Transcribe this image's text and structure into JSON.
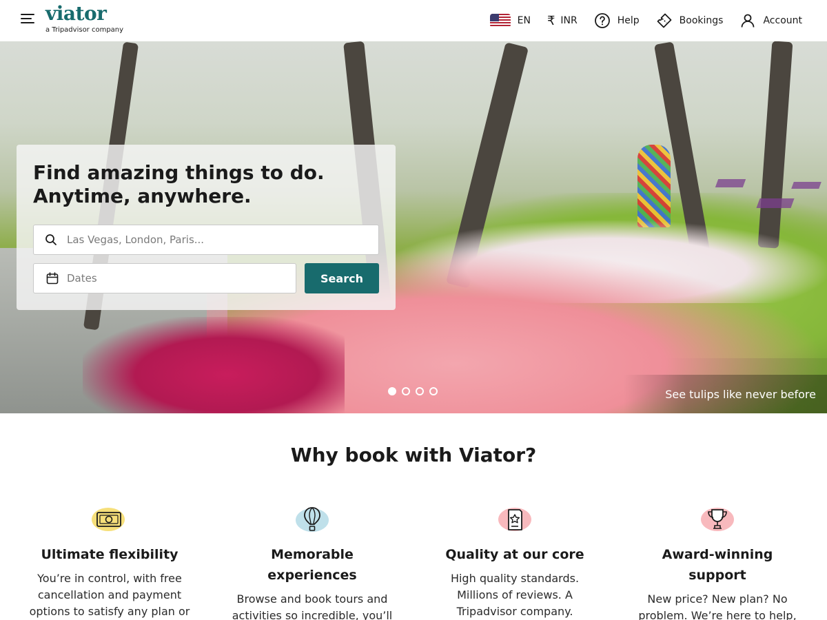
{
  "header": {
    "logo_text": "viator",
    "logo_subtitle": "a Tripadvisor company",
    "language": "EN",
    "currency": "INR",
    "help_label": "Help",
    "bookings_label": "Bookings",
    "account_label": "Account"
  },
  "hero": {
    "headline": "Find amazing things to do. Anytime, anywhere.",
    "location_placeholder": "Las Vegas, London, Paris...",
    "dates_placeholder": "Dates",
    "search_label": "Search",
    "caption": "See tulips like never before",
    "slide_count": 4,
    "active_slide": 1
  },
  "why": {
    "title": "Why book with Viator?",
    "features": [
      {
        "icon": "money-icon",
        "title": "Ultimate flexibility",
        "text": "You’re in control, with free cancellation and payment options to satisfy any plan or"
      },
      {
        "icon": "balloon-icon",
        "title": "Memorable experiences",
        "text": "Browse and book tours and activities so incredible, you’ll"
      },
      {
        "icon": "quality-badge-icon",
        "title": "Quality at our core",
        "text": "High quality standards. Millions of reviews. A Tripadvisor company."
      },
      {
        "icon": "trophy-icon",
        "title": "Award-winning support",
        "text": "New price? New plan? No problem. We’re here to help,"
      }
    ]
  },
  "colors": {
    "brand": "#186b6d",
    "icon_yellow": "#f6df7a",
    "icon_blue": "#bfe0ea",
    "icon_pink": "#f8b9bd"
  }
}
